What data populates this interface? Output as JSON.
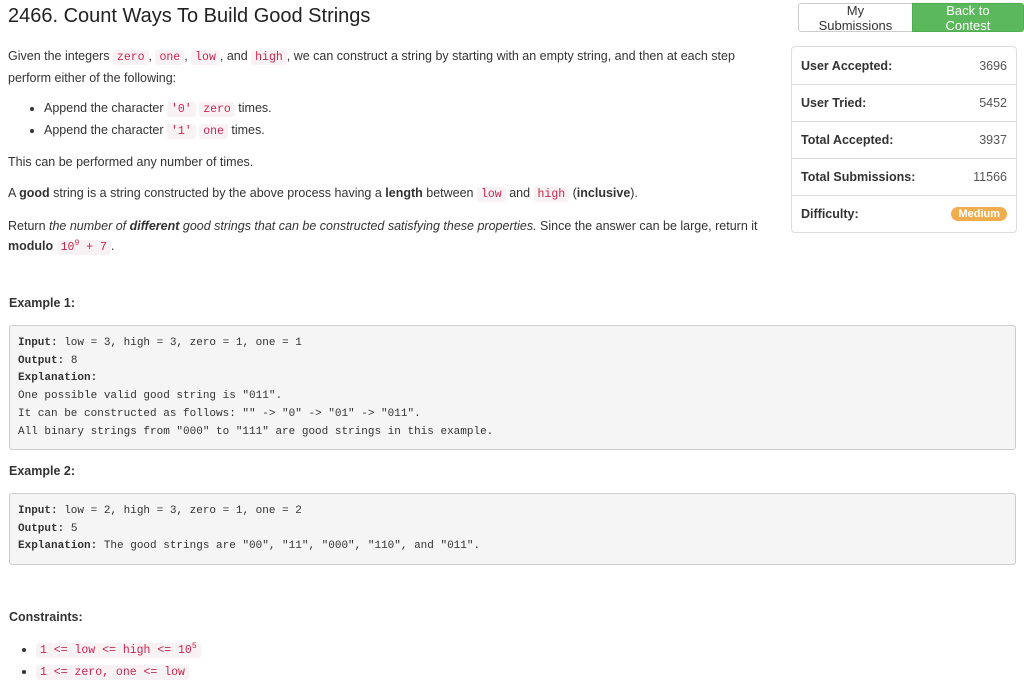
{
  "problem": {
    "title": "2466. Count Ways To Build Good Strings"
  },
  "buttons": {
    "my_submissions": "My Submissions",
    "back_to_contest": "Back to Contest"
  },
  "description": {
    "p1_a": "Given the integers ",
    "p1_zero": "zero",
    "p1_b": ", ",
    "p1_one": "one",
    "p1_c": ", ",
    "p1_low": "low",
    "p1_d": ", and ",
    "p1_high": "high",
    "p1_e": ", we can construct a string by starting with an empty string, and then at each step perform either of the following:",
    "bullet1_a": "Append the character ",
    "bullet1_char": "'0'",
    "bullet1_var": "zero",
    "bullet1_b": " times.",
    "bullet2_a": "Append the character ",
    "bullet2_char": "'1'",
    "bullet2_var": "one",
    "bullet2_b": " times.",
    "p2": "This can be performed any number of times.",
    "p3_a": "A ",
    "p3_good": "good",
    "p3_b": " string is a string constructed by the above process having a ",
    "p3_length": "length",
    "p3_c": " between ",
    "p3_low": "low",
    "p3_d": " and ",
    "p3_high": "high",
    "p3_e": " (",
    "p3_inclusive": "inclusive",
    "p3_f": ").",
    "p4_a": "Return ",
    "p4_b": "the number of ",
    "p4_different": "different",
    "p4_c": " good strings that can be constructed satisfying these properties.",
    "p4_d": " Since the answer can be large, return it ",
    "p4_modulo": "modulo",
    "p4_code_base": "10",
    "p4_code_exp": "9",
    "p4_code_rest": " + 7",
    "p4_end": "."
  },
  "example1": {
    "heading": "Example 1:",
    "input_label": "Input:",
    "input": " low = 3, high = 3, zero = 1, one = 1",
    "output_label": "Output:",
    "output": " 8",
    "explanation_label": "Explanation:",
    "line1": "One possible valid good string is \"011\".",
    "line2": "It can be constructed as follows: \"\" -> \"0\" -> \"01\" -> \"011\".",
    "line3": "All binary strings from \"000\" to \"111\" are good strings in this example."
  },
  "example2": {
    "heading": "Example 2:",
    "input_label": "Input:",
    "input": " low = 2, high = 3, zero = 1, one = 2",
    "output_label": "Output:",
    "output": " 5",
    "explanation_label": "Explanation:",
    "explanation": " The good strings are \"00\", \"11\", \"000\", \"110\", and \"011\"."
  },
  "constraints": {
    "heading": "Constraints:",
    "c1_base": "1 <= low <= high <= 10",
    "c1_exp": "5",
    "c2": "1 <= zero, one <= low"
  },
  "stats": {
    "user_accepted_label": "User Accepted:",
    "user_accepted": "3696",
    "user_tried_label": "User Tried:",
    "user_tried": "5452",
    "total_accepted_label": "Total Accepted:",
    "total_accepted": "3937",
    "total_submissions_label": "Total Submissions:",
    "total_submissions": "11566",
    "difficulty_label": "Difficulty:",
    "difficulty": "Medium"
  },
  "colors": {
    "accent_green": "#5cb85c",
    "badge_orange": "#f0ad4e",
    "code_red": "#c7254e"
  }
}
